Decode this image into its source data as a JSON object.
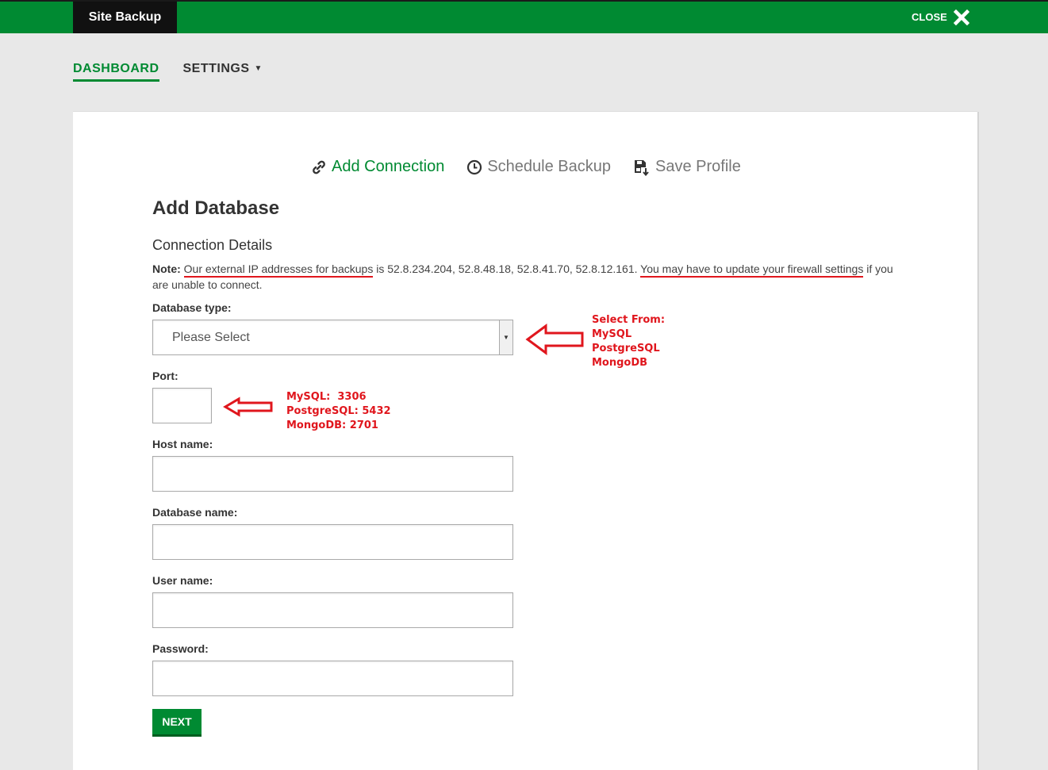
{
  "app": {
    "title": "Site Backup",
    "close_label": "CLOSE"
  },
  "nav": {
    "items": [
      {
        "label": "DASHBOARD",
        "active": true
      },
      {
        "label": "SETTINGS",
        "has_dropdown": true
      }
    ]
  },
  "tabs": [
    {
      "label": "Add Connection",
      "icon": "link-icon",
      "active": true
    },
    {
      "label": "Schedule Backup",
      "icon": "clock-icon"
    },
    {
      "label": "Save Profile",
      "icon": "save-icon"
    }
  ],
  "form": {
    "title": "Add Database",
    "section_title": "Connection Details",
    "note": {
      "prefix": "Note:",
      "part1": "Our external IP addresses for backups",
      "part2": " is 52.8.234.204, 52.8.48.18, 52.8.41.70, 52.8.12.161. ",
      "part3": "You may have to update your firewall settings",
      "part4": " if you are unable to connect."
    },
    "database_type": {
      "label": "Database type:",
      "value": "Please Select"
    },
    "port": {
      "label": "Port:",
      "value": ""
    },
    "host_name": {
      "label": "Host name:",
      "value": ""
    },
    "database_name": {
      "label": "Database name:",
      "value": ""
    },
    "user_name": {
      "label": "User name:",
      "value": ""
    },
    "password": {
      "label": "Password:",
      "value": ""
    },
    "next_label": "NEXT"
  },
  "annotations": {
    "select_from": "Select From:\nMySQL\nPostgreSQL\nMongoDB",
    "ports": "MySQL:  3306\nPostgreSQL: 5432\nMongoDB: 2701"
  },
  "colors": {
    "brand": "#008a32",
    "annotation": "#e0161d",
    "dark": "#111111"
  }
}
